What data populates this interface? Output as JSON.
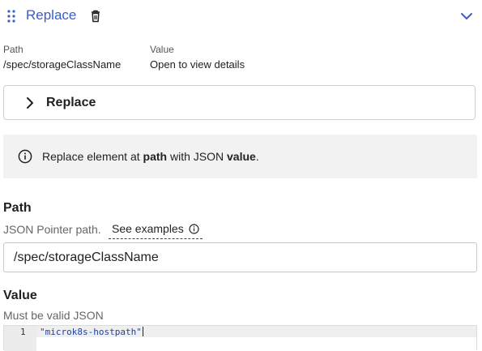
{
  "header": {
    "title": "Replace",
    "drag_icon": "drag-handle-icon",
    "delete_icon": "trash-icon",
    "collapse_icon": "chevron-down-icon"
  },
  "summary": {
    "path_label": "Path",
    "path_value": "/spec/storageClassName",
    "value_label": "Value",
    "value_value": "Open to view details"
  },
  "accordion": {
    "title": "Replace",
    "icon": "chevron-right-icon"
  },
  "info": {
    "icon": "info-icon",
    "text_before": "Replace element at ",
    "text_path": "path",
    "text_middle": " with JSON ",
    "text_value": "value",
    "text_after": "."
  },
  "path_section": {
    "title": "Path",
    "hint": "JSON Pointer path.",
    "examples_label": "See examples",
    "examples_icon": "info-icon",
    "input_value": "/spec/storageClassName"
  },
  "value_section": {
    "title": "Value",
    "hint": "Must be valid JSON",
    "editor": {
      "line_number": "1",
      "code": "\"microk8s-hostpath\""
    }
  },
  "colors": {
    "accent": "#3a5ccc",
    "info_background": "#f2f2f2",
    "code_string": "#1e3fa6"
  }
}
